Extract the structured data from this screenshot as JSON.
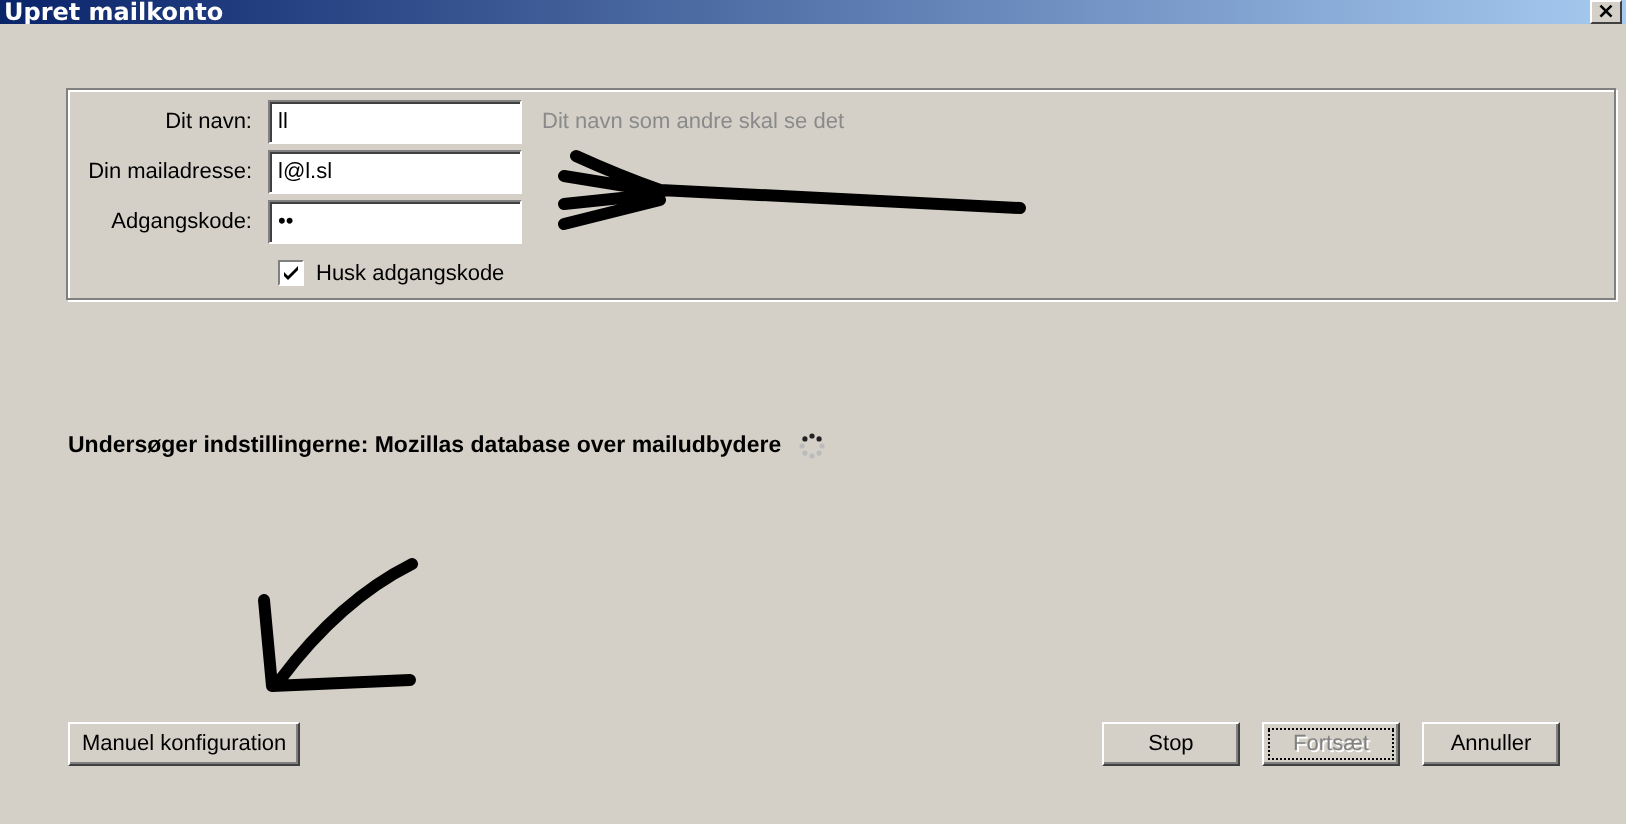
{
  "window": {
    "title": "Upret mailkonto",
    "close": "×"
  },
  "fields": [
    {
      "label": "Dit navn:",
      "value": "ll",
      "hint": "Dit navn som andre skal se det"
    },
    {
      "label": "Din mailadresse:",
      "value": "l@l.sl"
    },
    {
      "label": "Adgangskode:",
      "value": "••"
    }
  ],
  "remember": {
    "label": "Husk adgangskode",
    "checked": true
  },
  "status": {
    "text": "Undersøger indstillingerne: Mozillas database over mailudbydere",
    "busy": true
  },
  "buttons_left": [
    {
      "label": "Manuel konfiguration",
      "disabled": false
    }
  ],
  "buttons_right": [
    {
      "label": "Stop",
      "disabled": false
    },
    {
      "label": "Fortsæt",
      "disabled": true
    },
    {
      "label": "Annuller",
      "disabled": false
    }
  ]
}
